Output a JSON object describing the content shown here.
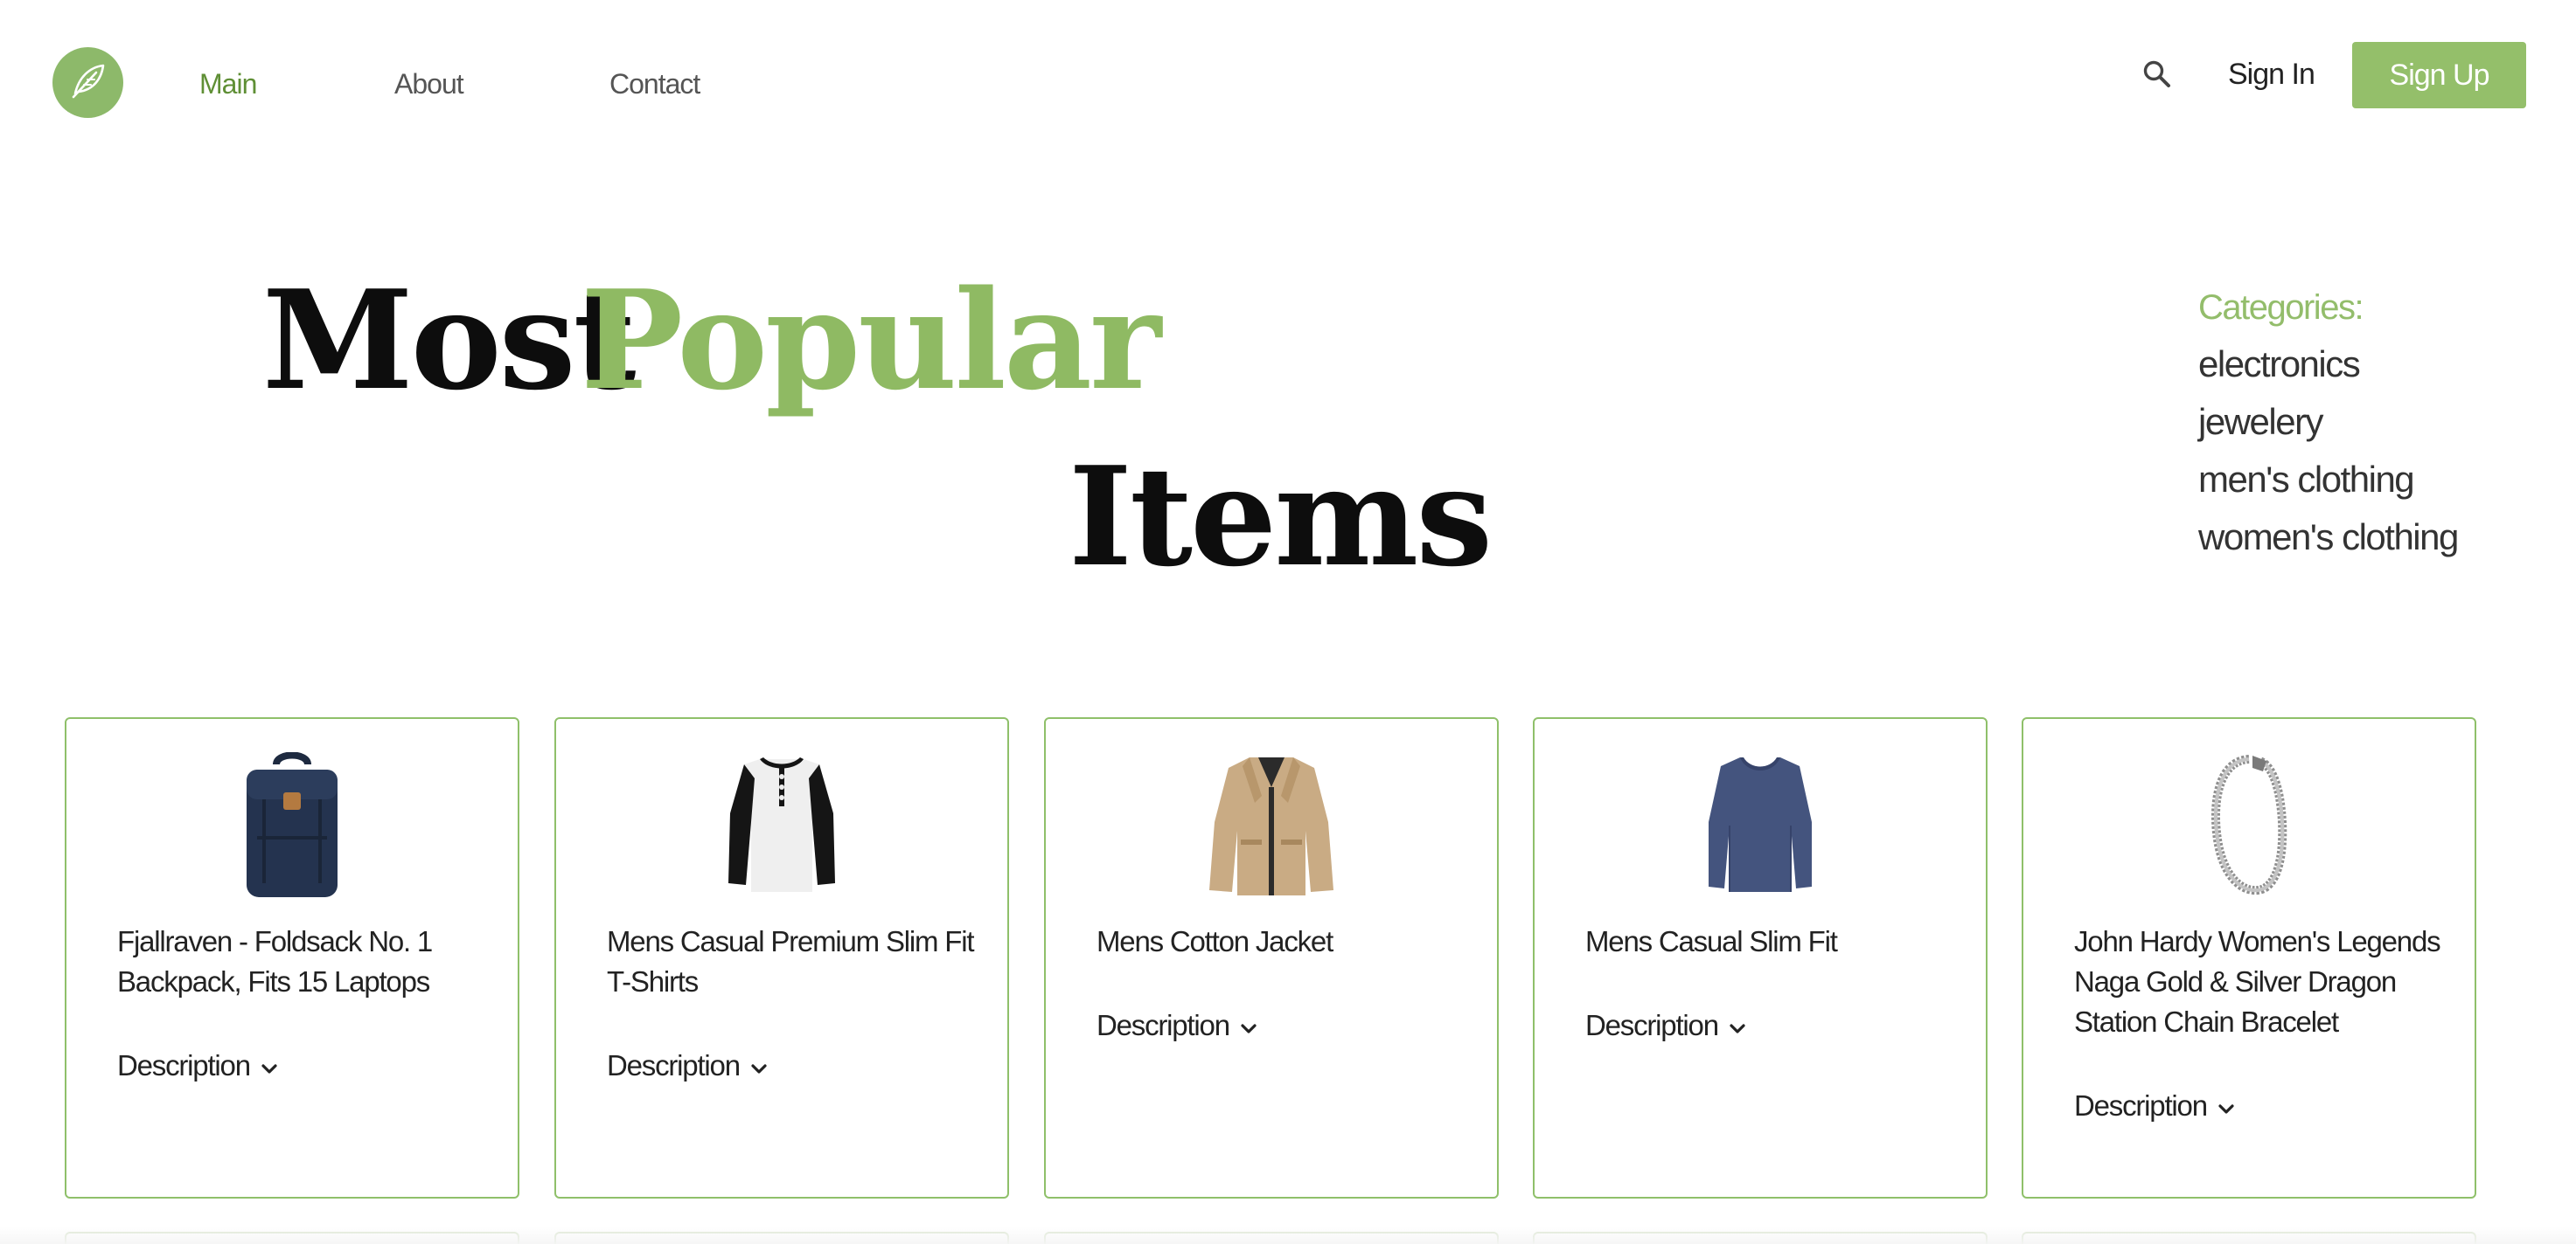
{
  "nav": {
    "links": [
      "Main",
      "About",
      "Contact"
    ],
    "active": "Main",
    "sign_in": "Sign In",
    "sign_up": "Sign Up",
    "icons": {
      "logo": "leaf-icon",
      "search": "search-icon"
    }
  },
  "hero": {
    "word1": "Most",
    "word2": "Popular",
    "word3": "Items"
  },
  "categories": {
    "title": "Categories:",
    "items": [
      "electronics",
      "jewelery",
      "men's clothing",
      "women's clothing"
    ]
  },
  "products": [
    {
      "title": "Fjallraven - Foldsack No. 1 Backpack, Fits 15 Laptops",
      "desc_label": "Description",
      "image": "backpack"
    },
    {
      "title": "Mens Casual Premium Slim Fit T-Shirts",
      "desc_label": "Description",
      "image": "henley-shirt"
    },
    {
      "title": "Mens Cotton Jacket",
      "desc_label": "Description",
      "image": "cotton-jacket"
    },
    {
      "title": "Mens Casual Slim Fit",
      "desc_label": "Description",
      "image": "long-sleeve-tee"
    },
    {
      "title": "John Hardy Women's Legends Naga Gold & Silver Dragon Station Chain Bracelet",
      "desc_label": "Description",
      "image": "dragon-bracelet"
    }
  ],
  "colors": {
    "accent": "#8fba63",
    "accent_dark": "#5f8f35",
    "button": "#94bf6a",
    "card_border": "#8fc06a"
  }
}
